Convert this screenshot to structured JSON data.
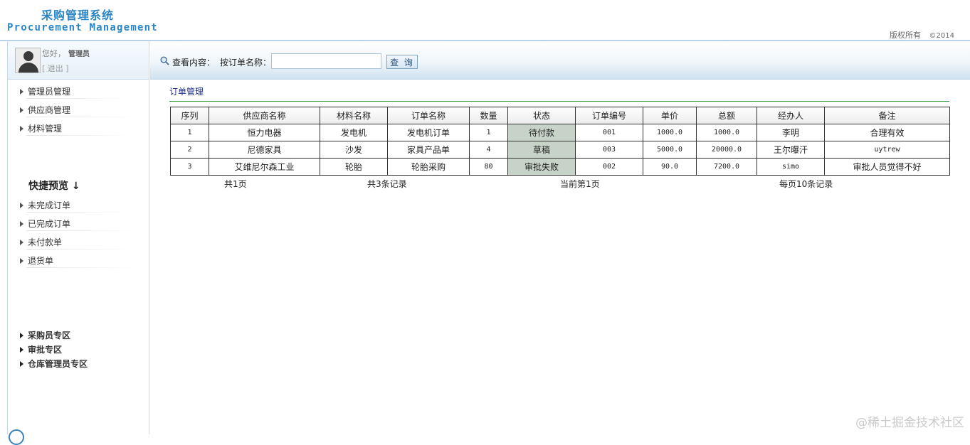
{
  "header": {
    "title_cn": "采购管理系统",
    "title_en": "Procurement Management",
    "copyright": "版权所有",
    "year": "©2014"
  },
  "user": {
    "greeting": "您好，",
    "name": "管理员",
    "logout": "[ 退出 ]"
  },
  "sidebar": {
    "main_items": [
      {
        "label": "管理员管理"
      },
      {
        "label": "供应商管理"
      },
      {
        "label": "材料管理"
      }
    ],
    "quick_title": "快捷预览",
    "quick_arrow": "↓",
    "quick_items": [
      {
        "label": "未完成订单"
      },
      {
        "label": "已完成订单"
      },
      {
        "label": "未付款单"
      },
      {
        "label": "退货单"
      }
    ],
    "zones": [
      {
        "label": "采购员专区"
      },
      {
        "label": "审批专区"
      },
      {
        "label": "仓库管理员专区"
      }
    ]
  },
  "search": {
    "view_label": "查看内容：",
    "order_label": "按订单名称：",
    "value": "",
    "button": "查 询"
  },
  "section": {
    "title": "订单管理"
  },
  "table": {
    "headers": [
      "序列",
      "供应商名称",
      "材料名称",
      "订单名称",
      "数量",
      "状态",
      "订单编号",
      "单价",
      "总额",
      "经办人",
      "备注"
    ],
    "rows": [
      [
        "1",
        "恒力电器",
        "发电机",
        "发电机订单",
        "1",
        "待付款",
        "001",
        "1000.0",
        "1000.0",
        "李明",
        "合理有效"
      ],
      [
        "2",
        "尼德家具",
        "沙发",
        "家具产品单",
        "4",
        "草稿",
        "003",
        "5000.0",
        "20000.0",
        "王尔曝汗",
        "uytrew"
      ],
      [
        "3",
        "艾维尼尔森工业",
        "轮胎",
        "轮胎采购",
        "80",
        "审批失败",
        "002",
        "90.0",
        "7200.0",
        "simo",
        "审批人员觉得不好"
      ]
    ]
  },
  "pager": {
    "total_pages": "共1页",
    "total_records": "共3条记录",
    "current_page": "当前第1页",
    "per_page": "每页10条记录"
  },
  "watermark": "@稀土掘金技术社区",
  "colors": {
    "brand": "#2a86c4",
    "status_cell": "#c7d3c9",
    "section_line": "#2f9a3a",
    "section_title": "#1a2f8a"
  }
}
